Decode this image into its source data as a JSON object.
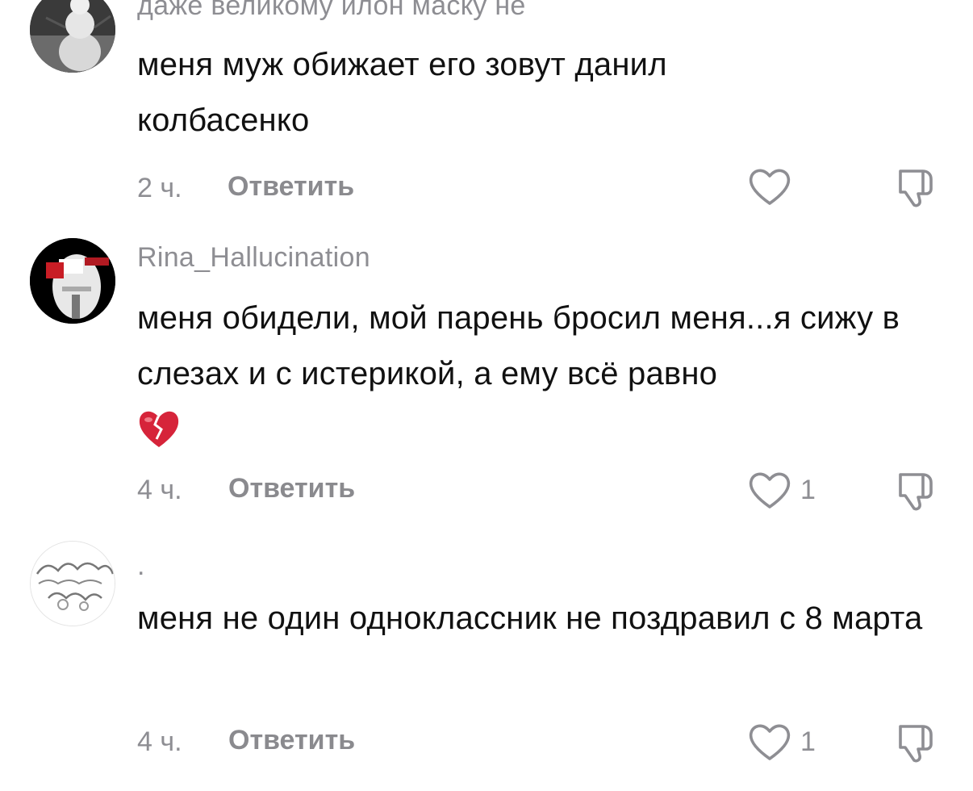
{
  "comments": [
    {
      "username": "даже великому илон маску не",
      "text": "меня муж обижает его зовут данил колбасенко",
      "time": "2 ч.",
      "reply_label": "Ответить",
      "likes": ""
    },
    {
      "username": "Rina_Hallucination",
      "text": "меня обидели, мой парень бросил меня...я сижу в слезах и с истерикой, а ему всё равно",
      "emoji": "broken-heart-icon",
      "time": "4 ч.",
      "reply_label": "Ответить",
      "likes": "1"
    },
    {
      "username": ".",
      "text": "меня не один одноклассник не поздравил с 8 марта",
      "time": "4 ч.",
      "reply_label": "Ответить",
      "likes": "1"
    }
  ],
  "colors": {
    "text": "#111111",
    "secondary": "#8e8e93",
    "heart_red": "#d6243a"
  }
}
